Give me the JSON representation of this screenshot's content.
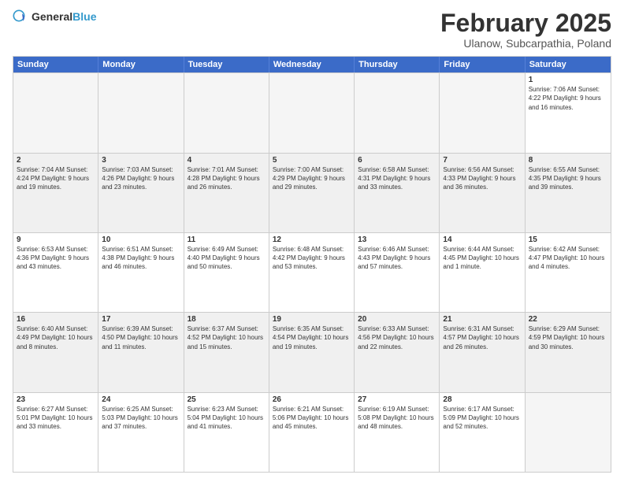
{
  "logo": {
    "general": "General",
    "blue": "Blue"
  },
  "title": "February 2025",
  "subtitle": "Ulanow, Subcarpathia, Poland",
  "days": [
    "Sunday",
    "Monday",
    "Tuesday",
    "Wednesday",
    "Thursday",
    "Friday",
    "Saturday"
  ],
  "weeks": [
    [
      {
        "day": "",
        "text": ""
      },
      {
        "day": "",
        "text": ""
      },
      {
        "day": "",
        "text": ""
      },
      {
        "day": "",
        "text": ""
      },
      {
        "day": "",
        "text": ""
      },
      {
        "day": "",
        "text": ""
      },
      {
        "day": "1",
        "text": "Sunrise: 7:06 AM\nSunset: 4:22 PM\nDaylight: 9 hours and 16 minutes."
      }
    ],
    [
      {
        "day": "2",
        "text": "Sunrise: 7:04 AM\nSunset: 4:24 PM\nDaylight: 9 hours and 19 minutes."
      },
      {
        "day": "3",
        "text": "Sunrise: 7:03 AM\nSunset: 4:26 PM\nDaylight: 9 hours and 23 minutes."
      },
      {
        "day": "4",
        "text": "Sunrise: 7:01 AM\nSunset: 4:28 PM\nDaylight: 9 hours and 26 minutes."
      },
      {
        "day": "5",
        "text": "Sunrise: 7:00 AM\nSunset: 4:29 PM\nDaylight: 9 hours and 29 minutes."
      },
      {
        "day": "6",
        "text": "Sunrise: 6:58 AM\nSunset: 4:31 PM\nDaylight: 9 hours and 33 minutes."
      },
      {
        "day": "7",
        "text": "Sunrise: 6:56 AM\nSunset: 4:33 PM\nDaylight: 9 hours and 36 minutes."
      },
      {
        "day": "8",
        "text": "Sunrise: 6:55 AM\nSunset: 4:35 PM\nDaylight: 9 hours and 39 minutes."
      }
    ],
    [
      {
        "day": "9",
        "text": "Sunrise: 6:53 AM\nSunset: 4:36 PM\nDaylight: 9 hours and 43 minutes."
      },
      {
        "day": "10",
        "text": "Sunrise: 6:51 AM\nSunset: 4:38 PM\nDaylight: 9 hours and 46 minutes."
      },
      {
        "day": "11",
        "text": "Sunrise: 6:49 AM\nSunset: 4:40 PM\nDaylight: 9 hours and 50 minutes."
      },
      {
        "day": "12",
        "text": "Sunrise: 6:48 AM\nSunset: 4:42 PM\nDaylight: 9 hours and 53 minutes."
      },
      {
        "day": "13",
        "text": "Sunrise: 6:46 AM\nSunset: 4:43 PM\nDaylight: 9 hours and 57 minutes."
      },
      {
        "day": "14",
        "text": "Sunrise: 6:44 AM\nSunset: 4:45 PM\nDaylight: 10 hours and 1 minute."
      },
      {
        "day": "15",
        "text": "Sunrise: 6:42 AM\nSunset: 4:47 PM\nDaylight: 10 hours and 4 minutes."
      }
    ],
    [
      {
        "day": "16",
        "text": "Sunrise: 6:40 AM\nSunset: 4:49 PM\nDaylight: 10 hours and 8 minutes."
      },
      {
        "day": "17",
        "text": "Sunrise: 6:39 AM\nSunset: 4:50 PM\nDaylight: 10 hours and 11 minutes."
      },
      {
        "day": "18",
        "text": "Sunrise: 6:37 AM\nSunset: 4:52 PM\nDaylight: 10 hours and 15 minutes."
      },
      {
        "day": "19",
        "text": "Sunrise: 6:35 AM\nSunset: 4:54 PM\nDaylight: 10 hours and 19 minutes."
      },
      {
        "day": "20",
        "text": "Sunrise: 6:33 AM\nSunset: 4:56 PM\nDaylight: 10 hours and 22 minutes."
      },
      {
        "day": "21",
        "text": "Sunrise: 6:31 AM\nSunset: 4:57 PM\nDaylight: 10 hours and 26 minutes."
      },
      {
        "day": "22",
        "text": "Sunrise: 6:29 AM\nSunset: 4:59 PM\nDaylight: 10 hours and 30 minutes."
      }
    ],
    [
      {
        "day": "23",
        "text": "Sunrise: 6:27 AM\nSunset: 5:01 PM\nDaylight: 10 hours and 33 minutes."
      },
      {
        "day": "24",
        "text": "Sunrise: 6:25 AM\nSunset: 5:03 PM\nDaylight: 10 hours and 37 minutes."
      },
      {
        "day": "25",
        "text": "Sunrise: 6:23 AM\nSunset: 5:04 PM\nDaylight: 10 hours and 41 minutes."
      },
      {
        "day": "26",
        "text": "Sunrise: 6:21 AM\nSunset: 5:06 PM\nDaylight: 10 hours and 45 minutes."
      },
      {
        "day": "27",
        "text": "Sunrise: 6:19 AM\nSunset: 5:08 PM\nDaylight: 10 hours and 48 minutes."
      },
      {
        "day": "28",
        "text": "Sunrise: 6:17 AM\nSunset: 5:09 PM\nDaylight: 10 hours and 52 minutes."
      },
      {
        "day": "",
        "text": ""
      }
    ]
  ]
}
